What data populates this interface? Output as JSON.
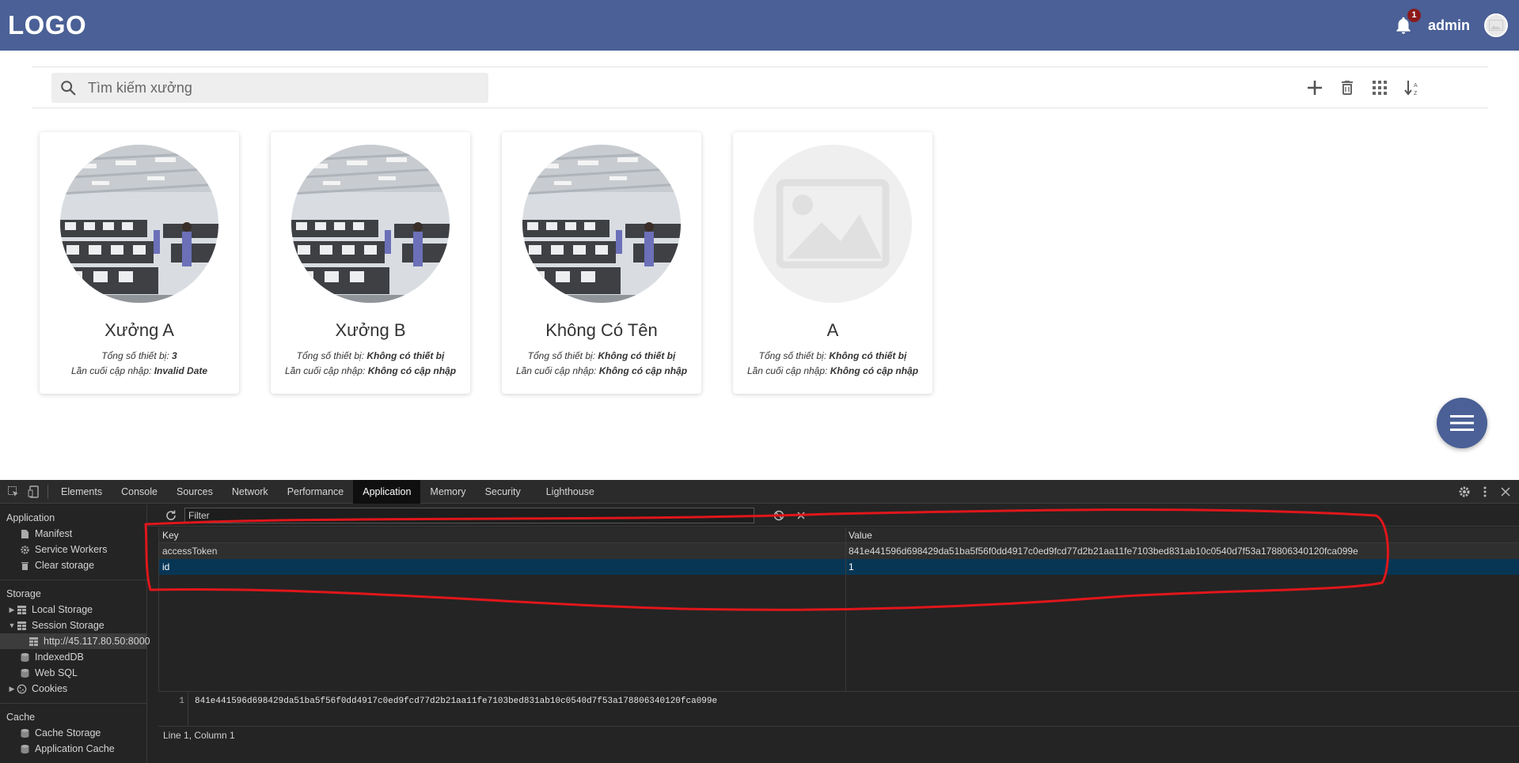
{
  "header": {
    "logo": "LOGO",
    "notification_count": "1",
    "username": "admin"
  },
  "toolbar": {
    "search_placeholder": "Tìm kiếm xưởng",
    "actions": [
      {
        "icon": "plus-icon"
      },
      {
        "icon": "trash-icon"
      },
      {
        "icon": "grid-icon"
      },
      {
        "icon": "sort-az-icon"
      }
    ]
  },
  "cards": [
    {
      "title": "Xưởng A",
      "devices_label": "Tổng số thiết bị: ",
      "devices_value": "3",
      "updated_label": "Lần cuối cập nhập: ",
      "updated_value": "Invalid Date",
      "image": "factory"
    },
    {
      "title": "Xưởng B",
      "devices_label": "Tổng số thiết bị: ",
      "devices_value": "Không có thiết bị",
      "updated_label": "Lần cuối cập nhập: ",
      "updated_value": "Không có cập nhập",
      "image": "factory"
    },
    {
      "title": "Không Có Tên",
      "devices_label": "Tổng số thiết bị: ",
      "devices_value": "Không có thiết bị",
      "updated_label": "Lần cuối cập nhập: ",
      "updated_value": "Không có cập nhập",
      "image": "factory"
    },
    {
      "title": "A",
      "devices_label": "Tổng số thiết bị: ",
      "devices_value": "Không có thiết bị",
      "updated_label": "Lần cuối cập nhập: ",
      "updated_value": "Không có cập nhập",
      "image": "placeholder"
    }
  ],
  "devtools": {
    "tabs": [
      "Elements",
      "Console",
      "Sources",
      "Network",
      "Performance",
      "Application",
      "Memory",
      "Security",
      "Lighthouse"
    ],
    "active_tab": "Application",
    "sidebar": {
      "application_title": "Application",
      "application_items": [
        "Manifest",
        "Service Workers",
        "Clear storage"
      ],
      "storage_title": "Storage",
      "local_storage": "Local Storage",
      "session_storage": "Session Storage",
      "session_origin": "http://45.117.80.50:8000",
      "indexeddb": "IndexedDB",
      "websql": "Web SQL",
      "cookies": "Cookies",
      "cache_title": "Cache",
      "cache_storage": "Cache Storage",
      "application_cache": "Application Cache"
    },
    "filter_placeholder": "Filter",
    "table": {
      "key_header": "Key",
      "value_header": "Value",
      "rows": [
        {
          "key": "accessToken",
          "value": "841e441596d698429da51ba5f56f0dd4917c0ed9fcd77d2b21aa11fe7103bed831ab10c0540d7f53a178806340120fca099e"
        },
        {
          "key": "id",
          "value": "1"
        }
      ]
    },
    "preview": {
      "line_number": "1",
      "content": "841e441596d698429da51ba5f56f0dd4917c0ed9fcd77d2b21aa11fe7103bed831ab10c0540d7f53a178806340120fca099e"
    },
    "status": "Line 1, Column 1"
  },
  "colors": {
    "brand": "#4a6096",
    "badge": "#8b1a1a",
    "annotation": "#e0161b",
    "devtools_selected_row": "#073655"
  }
}
